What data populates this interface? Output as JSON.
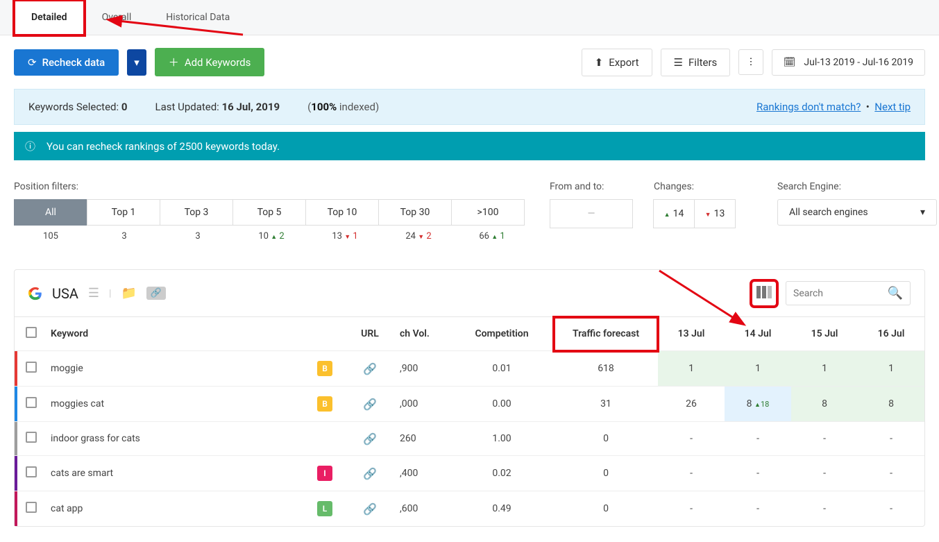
{
  "tabs": {
    "detailed": "Detailed",
    "overall": "Overall",
    "historical": "Historical Data"
  },
  "toolbar": {
    "recheck": "Recheck data",
    "add_keywords": "Add Keywords",
    "export": "Export",
    "filters": "Filters",
    "date_range": "Jul-13 2019 - Jul-16 2019"
  },
  "infobar": {
    "selected_label": "Keywords Selected:",
    "selected_count": "0",
    "updated_label": "Last Updated:",
    "updated_value": "16 Jul, 2019",
    "progress_pct": "100%",
    "progress_word": " indexed",
    "link_mismatch": "Rankings don't match?",
    "link_next": "Next tip"
  },
  "notice": "You can recheck rankings of 2500 keywords today.",
  "filters": {
    "pos_label": "Position filters:",
    "fromto_label": "From and to:",
    "changes_label": "Changes:",
    "se_label": "Search Engine:",
    "se_value": "All search engines",
    "fromto_placeholder": "—",
    "changes_up": "14",
    "changes_down": "13",
    "items": [
      {
        "label": "All",
        "count": "105",
        "delta": "",
        "dir": ""
      },
      {
        "label": "Top 1",
        "count": "3",
        "delta": "",
        "dir": ""
      },
      {
        "label": "Top 3",
        "count": "3",
        "delta": "",
        "dir": ""
      },
      {
        "label": "Top 5",
        "count": "10",
        "delta": "2",
        "dir": "up"
      },
      {
        "label": "Top 10",
        "count": "13",
        "delta": "1",
        "dir": "down"
      },
      {
        "label": "Top 30",
        "count": "24",
        "delta": "2",
        "dir": "down"
      },
      {
        "label": ">100",
        "count": "66",
        "delta": "1",
        "dir": "up"
      }
    ]
  },
  "panel": {
    "country": "USA",
    "search_placeholder": "Search"
  },
  "table": {
    "headers": {
      "keyword": "Keyword",
      "url": "URL",
      "vol": "ch Vol.",
      "comp": "Competition",
      "traffic": "Traffic forecast",
      "d1": "13 Jul",
      "d2": "14 Jul",
      "d3": "15 Jul",
      "d4": "16 Jul"
    },
    "rows": [
      {
        "bar": "bar-red",
        "kw": "moggie",
        "badge": "B",
        "bcls": "b-yellow",
        "vol": ",900",
        "comp": "0.01",
        "traffic": "618",
        "r1": "1",
        "r1c": "g",
        "r2": "1",
        "r2c": "g",
        "r2d": "",
        "r3": "1",
        "r3c": "g",
        "r4": "1",
        "r4c": "g"
      },
      {
        "bar": "bar-blue",
        "kw": "moggies cat",
        "badge": "B",
        "bcls": "b-yellow",
        "vol": ",000",
        "comp": "0.00",
        "traffic": "31",
        "r1": "26",
        "r1c": "",
        "r2": "8",
        "r2c": "b",
        "r2d": "18",
        "r3": "8",
        "r3c": "g",
        "r4": "8",
        "r4c": "g"
      },
      {
        "bar": "bar-gray",
        "kw": "indoor grass for cats",
        "badge": "",
        "bcls": "",
        "vol": "260",
        "comp": "1.00",
        "traffic": "0",
        "r1": "-",
        "r1c": "",
        "r2": "-",
        "r2c": "",
        "r2d": "",
        "r3": "-",
        "r3c": "",
        "r4": "-",
        "r4c": ""
      },
      {
        "bar": "bar-purple",
        "kw": "cats are smart",
        "badge": "I",
        "bcls": "b-pink",
        "vol": ",400",
        "comp": "0.02",
        "traffic": "0",
        "r1": "-",
        "r1c": "",
        "r2": "-",
        "r2c": "",
        "r2d": "",
        "r3": "-",
        "r3c": "",
        "r4": "-",
        "r4c": ""
      },
      {
        "bar": "bar-pink",
        "kw": "cat app",
        "badge": "L",
        "bcls": "b-green",
        "vol": ",600",
        "comp": "0.49",
        "traffic": "0",
        "r1": "-",
        "r1c": "",
        "r2": "-",
        "r2c": "",
        "r2d": "",
        "r3": "-",
        "r3c": "",
        "r4": "-",
        "r4c": ""
      }
    ]
  }
}
